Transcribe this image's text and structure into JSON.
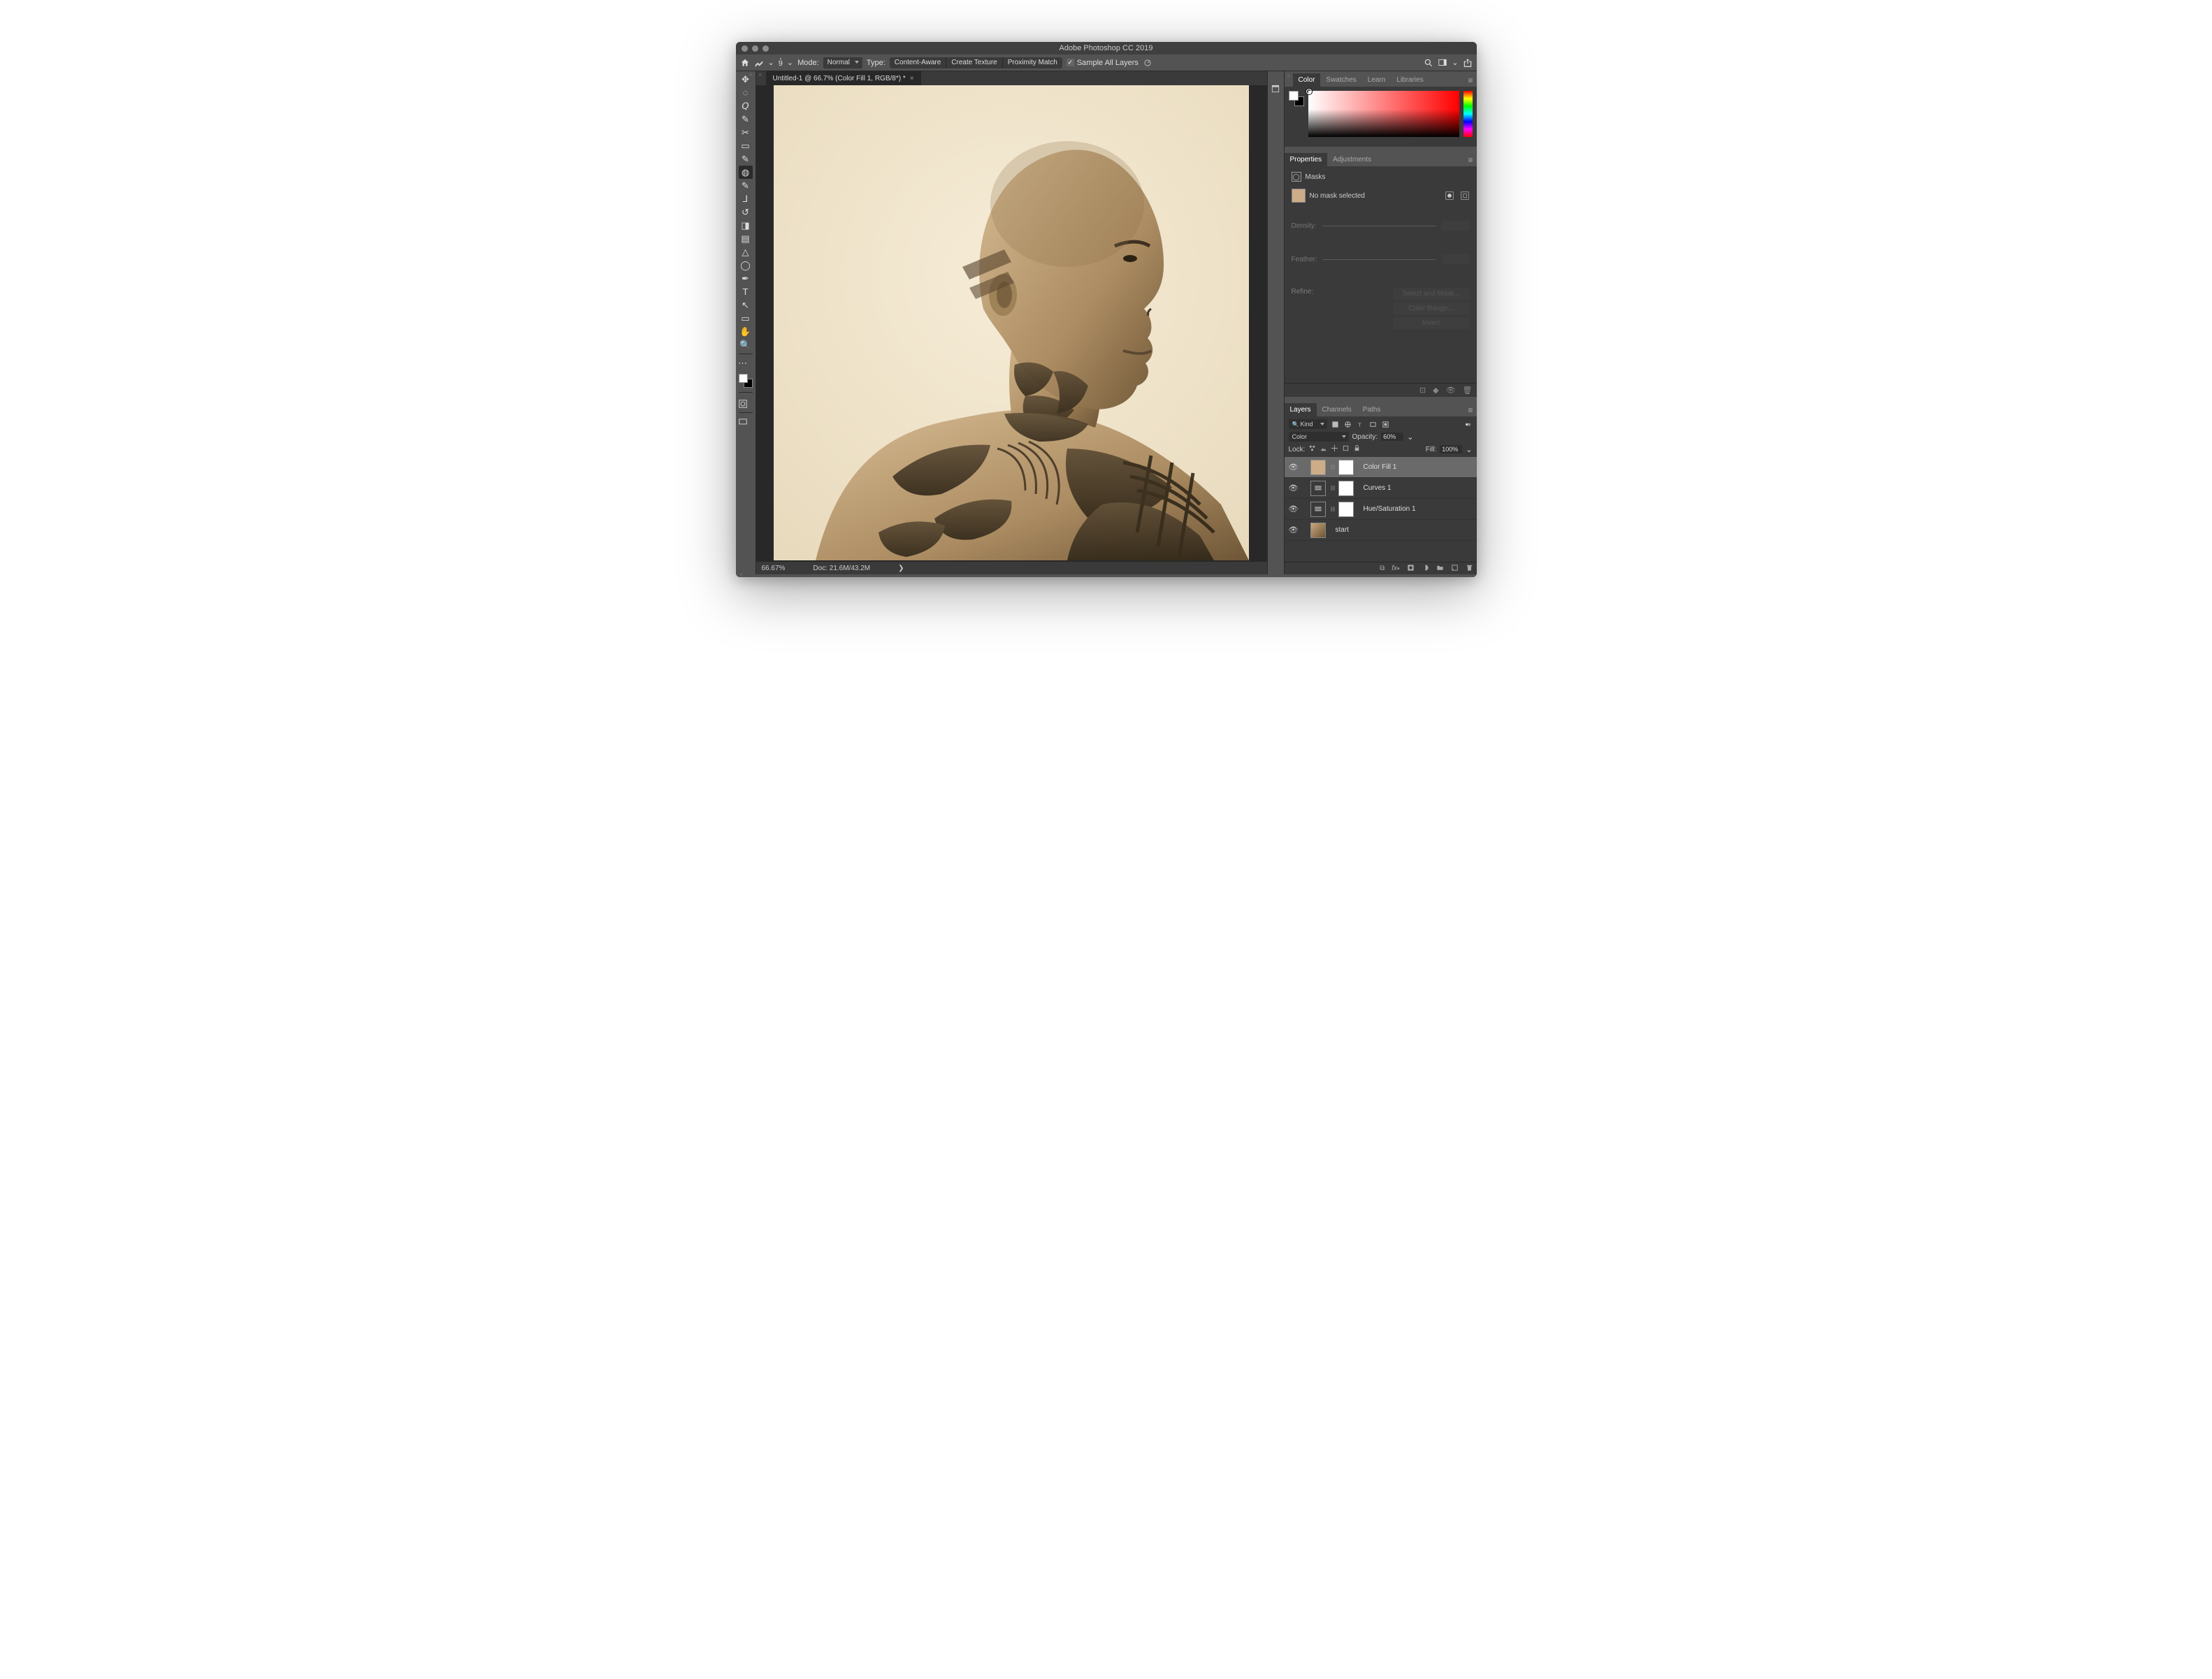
{
  "window": {
    "title": "Adobe Photoshop CC 2019"
  },
  "options_bar": {
    "brush_size": "9",
    "mode_label": "Mode:",
    "mode_value": "Normal",
    "type_label": "Type:",
    "type_buttons": [
      "Content-Aware",
      "Create Texture",
      "Proximity Match"
    ],
    "sample_all": "Sample All Layers"
  },
  "document_tab": {
    "label": "Untitled-1 @ 66.7% (Color Fill 1, RGB/8*) *"
  },
  "statusbar": {
    "zoom": "66.67%",
    "doc": "Doc: 21.6M/43.2M",
    "arrow": "❯"
  },
  "tools": [
    {
      "name": "move-tool",
      "glyph": "✥"
    },
    {
      "name": "marquee-tool",
      "glyph": "◌"
    },
    {
      "name": "lasso-tool",
      "glyph": "𝘘"
    },
    {
      "name": "quick-select-tool",
      "glyph": "✎"
    },
    {
      "name": "crop-tool",
      "glyph": "✂"
    },
    {
      "name": "frame-tool",
      "glyph": "▭"
    },
    {
      "name": "eyedropper-tool",
      "glyph": "✎"
    },
    {
      "name": "spot-heal-tool",
      "glyph": "◍",
      "active": true
    },
    {
      "name": "brush-tool",
      "glyph": "✎"
    },
    {
      "name": "clone-stamp-tool",
      "glyph": "⅃"
    },
    {
      "name": "history-brush-tool",
      "glyph": "↺"
    },
    {
      "name": "eraser-tool",
      "glyph": "◨"
    },
    {
      "name": "gradient-tool",
      "glyph": "▤"
    },
    {
      "name": "blur-tool",
      "glyph": "△"
    },
    {
      "name": "dodge-tool",
      "glyph": "◯"
    },
    {
      "name": "pen-tool",
      "glyph": "✒"
    },
    {
      "name": "type-tool",
      "glyph": "T"
    },
    {
      "name": "path-select-tool",
      "glyph": "↖"
    },
    {
      "name": "rectangle-tool",
      "glyph": "▭"
    },
    {
      "name": "hand-tool",
      "glyph": "✋"
    },
    {
      "name": "zoom-tool",
      "glyph": "🔍"
    }
  ],
  "panels": {
    "color_tabs": [
      "Color",
      "Swatches",
      "Learn",
      "Libraries"
    ],
    "props_tabs": [
      "Properties",
      "Adjustments"
    ],
    "layers_tabs": [
      "Layers",
      "Channels",
      "Paths"
    ],
    "properties": {
      "masks_label": "Masks",
      "mask_status": "No mask selected",
      "density_label": "Density:",
      "feather_label": "Feather:",
      "refine_label": "Refine:",
      "select_mask_btn": "Select and Mask...",
      "color_range_btn": "Color Range...",
      "invert_btn": "Invert"
    },
    "layers": {
      "filter_kind": "Kind",
      "blend_mode": "Color",
      "opacity_label": "Opacity:",
      "opacity_value": "60%",
      "lock_label": "Lock:",
      "fill_label": "Fill:",
      "fill_value": "100%",
      "kind_search_placeholder": "Kind",
      "rows": [
        {
          "name": "Color Fill 1",
          "selected": true,
          "color": "#cdac88",
          "mask": true,
          "adj": false
        },
        {
          "name": "Curves 1",
          "selected": false,
          "adj": true,
          "mask": true
        },
        {
          "name": "Hue/Saturation 1",
          "selected": false,
          "adj": true,
          "mask": true
        },
        {
          "name": "start",
          "selected": false,
          "image": true
        }
      ]
    }
  }
}
